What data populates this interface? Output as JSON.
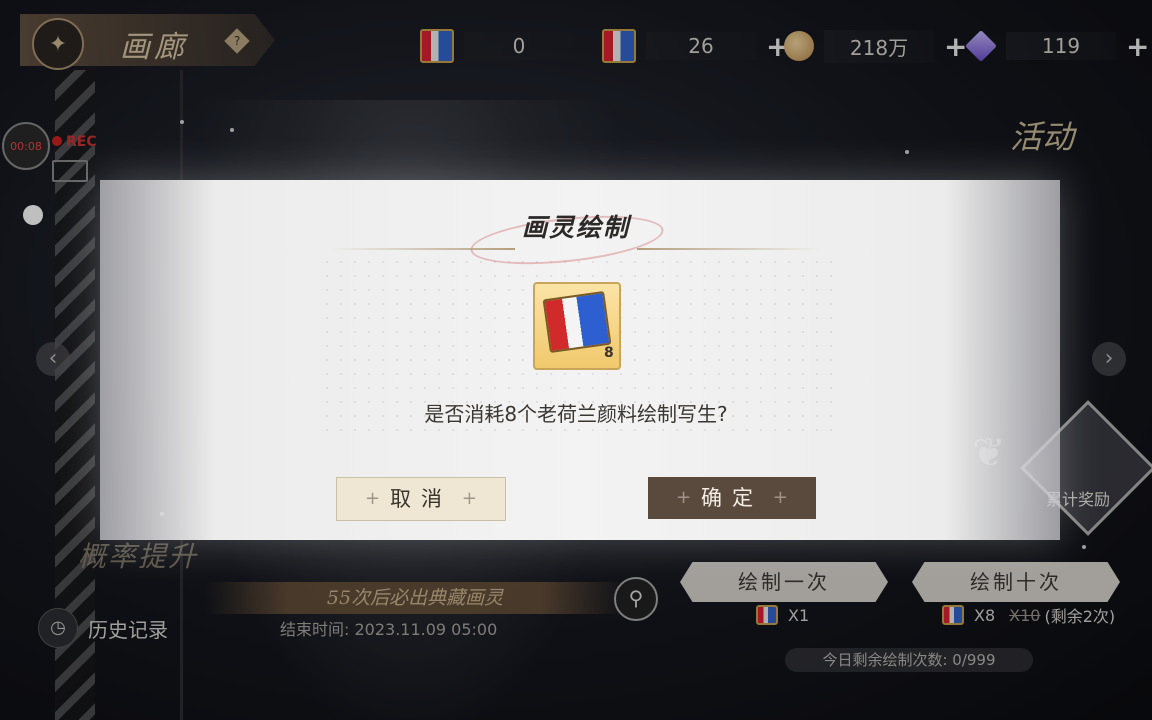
{
  "topbar": {
    "gallery_title": "画廊",
    "help_symbol": "?",
    "resources": [
      {
        "icon": "paint-icon",
        "value": "0",
        "has_plus": false
      },
      {
        "icon": "paint-icon",
        "value": "26",
        "has_plus": true
      },
      {
        "icon": "coin-icon",
        "value": "218万",
        "has_plus": true
      },
      {
        "icon": "gem-icon",
        "value": "119",
        "has_plus": true
      }
    ],
    "plus_symbol": "+"
  },
  "activity_label": "活动",
  "hud": {
    "rec_timer": "00:08",
    "rec_label": "REC"
  },
  "modal": {
    "title": "画灵绘制",
    "item_icon": "dutch-paint-icon",
    "item_count": "8",
    "question": "是否消耗8个老荷兰颜料绘制写生?",
    "cancel_label": "取消",
    "confirm_label": "确定",
    "btn_deco": "+"
  },
  "bottom": {
    "probability_up": "概率提升",
    "history_label": "历史记录",
    "banner_text": "55次后必出典藏画灵",
    "end_time": "结束时间: 2023.11.09 05:00",
    "draw_one_label": "绘制一次",
    "draw_ten_label": "绘制十次",
    "draw_one_cost": "X1",
    "draw_ten_cost": "X8",
    "draw_ten_original": "X10",
    "draw_ten_remaining": "(剩余2次)",
    "today_remaining": "今日剩余绘制次数: 0/999",
    "reward_label": "累计奖励"
  },
  "colors": {
    "confirm_button": "#5a4a3e",
    "cancel_button": "#efe6d4",
    "gold_accent": "#c8a55a"
  }
}
